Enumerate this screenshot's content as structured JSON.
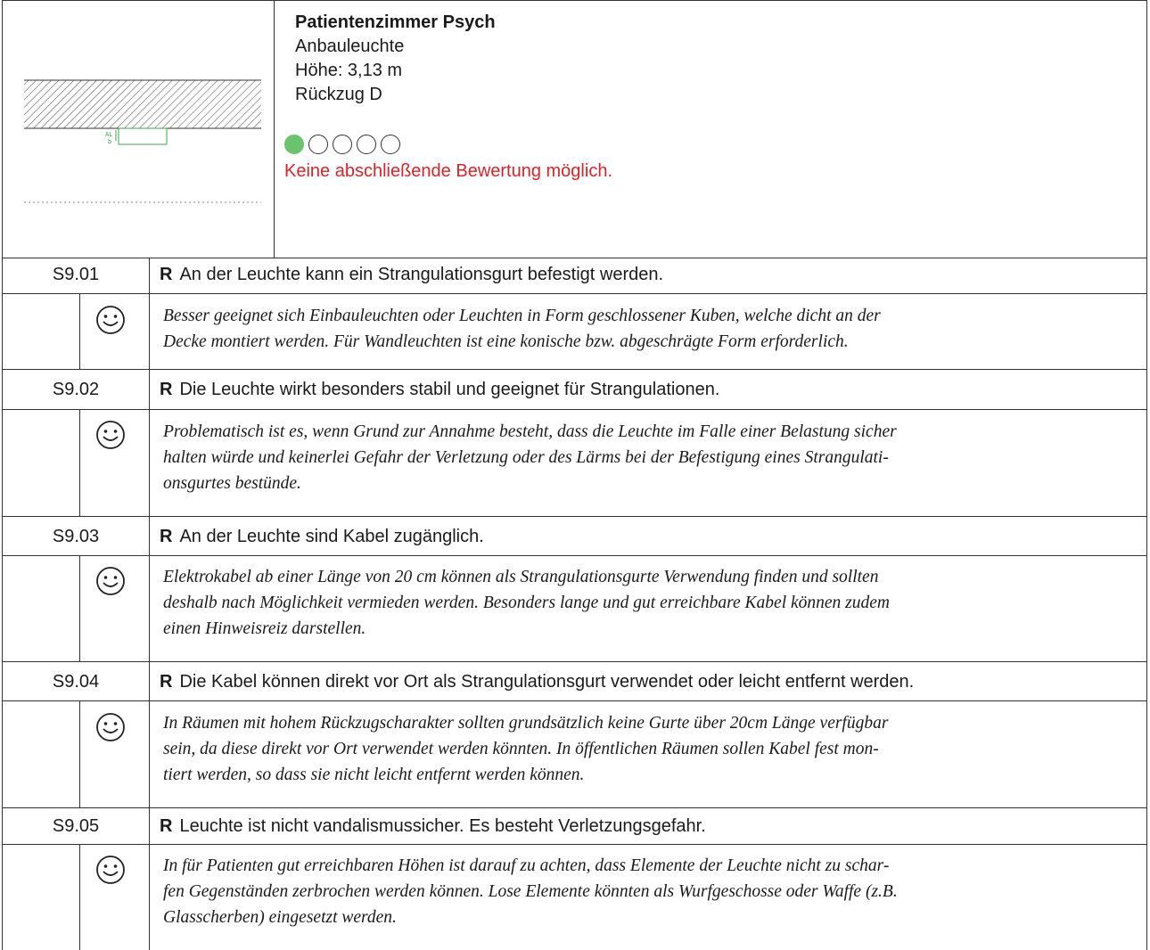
{
  "header": {
    "title": "Patientenzimmer Psych",
    "lines": [
      "Anbauleuchte",
      "Höhe:  3,13 m",
      "Rückzug D"
    ],
    "drawing_label_1": "AL",
    "drawing_label_2": "b",
    "rating": {
      "filled": 1,
      "total": 5,
      "fill_color": "#6ac46e"
    },
    "rating_note": "Keine abschließende Bewertung möglich."
  },
  "rows": [
    {
      "code": "S9.01",
      "marker": "R",
      "finding": "An der Leuchte kann ein Strangulationsgurt befestigt werden.",
      "comment": [
        "Besser geeignet sich Einbauleuchten oder Leuchten in Form geschlossener Kuben, welche dicht an der",
        "Decke montiert werden. Für Wandleuchten ist eine konische bzw. abgeschrägte Form erforderlich."
      ]
    },
    {
      "code": "S9.02",
      "marker": "R",
      "finding": "Die Leuchte wirkt besonders stabil und geeignet für Strangulationen.",
      "comment": [
        "Problematisch ist es, wenn Grund zur Annahme besteht, dass die Leuchte im Falle einer Belastung sicher",
        "halten würde und keinerlei Gefahr der Verletzung oder des Lärms bei der Befestigung eines Strangulati-",
        "onsgurtes bestünde."
      ]
    },
    {
      "code": "S9.03",
      "marker": "R",
      "finding": "An der Leuchte sind Kabel zugänglich.",
      "comment": [
        "Elektrokabel ab einer Länge von 20 cm können als Strangulationsgurte Verwendung finden und sollten",
        "deshalb nach Möglichkeit vermieden werden. Besonders lange und gut erreichbare Kabel können zudem",
        "einen Hinweisreiz darstellen."
      ]
    },
    {
      "code": "S9.04",
      "marker": "R",
      "finding": "Die Kabel können direkt vor Ort als Strangulationsgurt verwendet oder leicht entfernt werden.",
      "comment": [
        "In Räumen mit hohem Rückzugscharakter sollten grundsätzlich keine Gurte über 20cm Länge verfügbar",
        "sein, da diese direkt vor Ort verwendet werden könnten. In öffentlichen Räumen sollen Kabel fest mon-",
        "tiert werden, so dass sie nicht leicht entfernt werden können."
      ]
    },
    {
      "code": "S9.05",
      "marker": "R",
      "finding": "Leuchte ist nicht vandalismussicher. Es besteht Verletzungsgefahr.",
      "comment": [
        "In für Patienten gut erreichbaren Höhen ist darauf zu achten, dass Elemente der Leuchte nicht zu schar-",
        "fen Gegenständen zerbrochen werden können. Lose Elemente könnten als Wurfgeschosse oder Waffe (z.B.",
        "Glasscherben) eingesetzt werden."
      ]
    }
  ]
}
